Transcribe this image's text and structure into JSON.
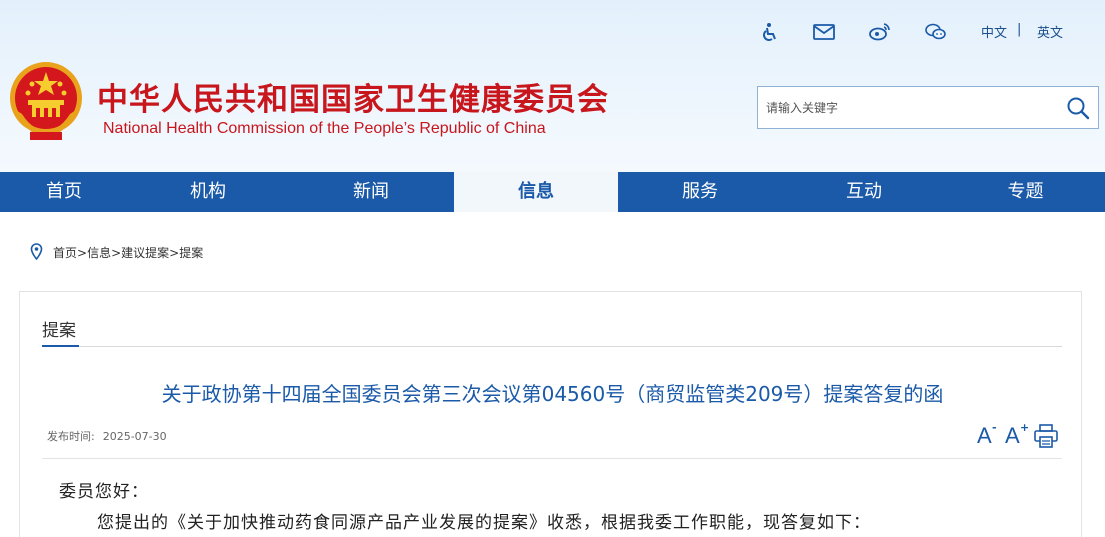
{
  "header": {
    "title": "中华人民共和国国家卫生健康委员会",
    "subtitle": "National Health Commission of the People’s Republic of China",
    "emblem_icon": "national-emblem-icon",
    "tools": [
      "accessibility-icon",
      "mail-icon",
      "weibo-icon",
      "wechat-icon"
    ],
    "lang_zh": "中文",
    "lang_sep": "|",
    "lang_en": "英文"
  },
  "search": {
    "placeholder": "请输入关键字",
    "icon": "search-icon"
  },
  "nav": {
    "items": [
      "首页",
      "机构",
      "新闻",
      "信息",
      "服务",
      "互动",
      "专题"
    ],
    "active": "信息"
  },
  "breadcrumb": {
    "icon": "location-pin-icon",
    "items": [
      "首页",
      "信息",
      "建议提案",
      "提案"
    ],
    "sep": ">"
  },
  "section": {
    "label": "提案"
  },
  "article": {
    "title": "关于政协第十四届全国委员会第三次会议第04560号（商贸监管类209号）提案答复的函",
    "publish_label": "发布时间:",
    "publish_date": "2025-07-30",
    "font_decrease": "A",
    "font_decrease_sign": "-",
    "font_increase": "A",
    "font_increase_sign": "+",
    "print_icon": "print-icon",
    "greeting": "委员您好：",
    "paragraph1": "您提出的《关于加快推动药食同源产品产业发展的提案》收悉，根据我委工作职能，现答复如下："
  },
  "colors": {
    "brand_red": "#c8161d",
    "nav_blue": "#1b5aa8",
    "header_bg": "#e3f0fb"
  }
}
